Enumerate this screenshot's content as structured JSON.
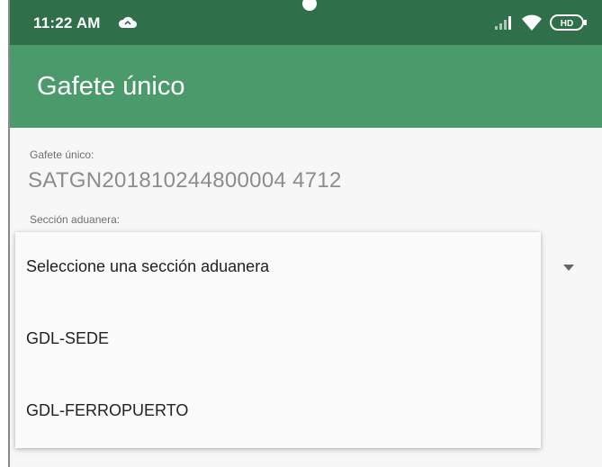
{
  "status_bar": {
    "time": "11:22 AM",
    "notification_icon": "cloud-icon",
    "signal_icon": "cellular-signal-icon",
    "wifi_icon": "wifi-icon",
    "battery_icon": "battery-hd-icon",
    "battery_label": "HD",
    "background_color": "#2f6f4a"
  },
  "app_bar": {
    "title": "Gafete único",
    "background_color": "#4a9a6b"
  },
  "form": {
    "badge_label": "Gafete único:",
    "badge_value": "SATGN201810244800004 4712",
    "customs_section_label": "Sección aduanera:",
    "spinner_arrow_icon": "dropdown-arrow-icon"
  },
  "dropdown": {
    "options": [
      "Seleccione una sección aduanera",
      "GDL-SEDE",
      "GDL-FERROPUERTO"
    ]
  }
}
